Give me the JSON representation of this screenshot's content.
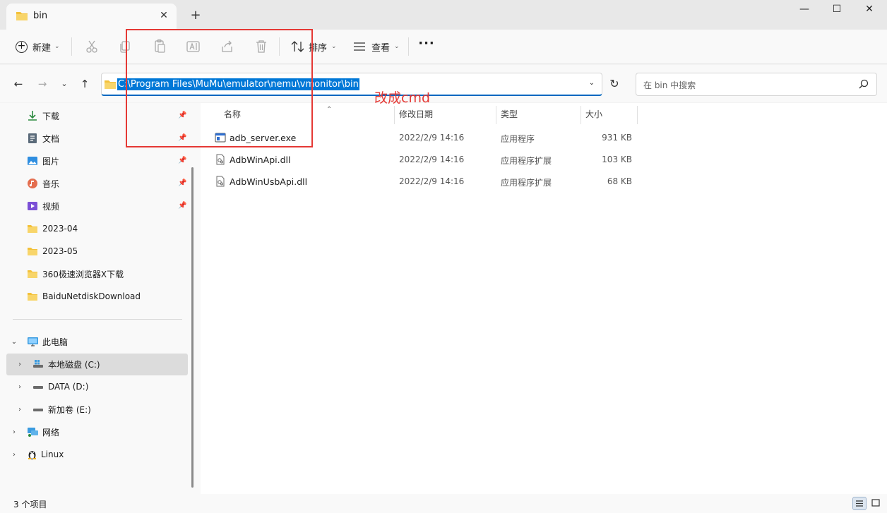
{
  "tab": {
    "title": "bin"
  },
  "toolbar": {
    "new_label": "新建",
    "sort_label": "排序",
    "view_label": "查看"
  },
  "address": {
    "path": "C:\\Program Files\\MuMu\\emulator\\nemu\\vmonitor\\bin"
  },
  "search": {
    "placeholder": "在 bin 中搜索"
  },
  "sidebar": {
    "quick_access": [
      {
        "label": "下载",
        "icon": "download-icon"
      },
      {
        "label": "文档",
        "icon": "document-icon"
      },
      {
        "label": "图片",
        "icon": "pictures-icon"
      },
      {
        "label": "音乐",
        "icon": "music-icon"
      },
      {
        "label": "视频",
        "icon": "video-icon"
      },
      {
        "label": "2023-04",
        "icon": "folder-icon"
      },
      {
        "label": "2023-05",
        "icon": "folder-icon"
      },
      {
        "label": "360极速浏览器X下载",
        "icon": "folder-icon"
      },
      {
        "label": "BaiduNetdiskDownload",
        "icon": "folder-icon"
      }
    ],
    "tree": [
      {
        "label": "此电脑",
        "icon": "computer-icon"
      },
      {
        "label": "本地磁盘 (C:)",
        "icon": "drive-icon"
      },
      {
        "label": "DATA (D:)",
        "icon": "drive-icon"
      },
      {
        "label": "新加卷 (E:)",
        "icon": "drive-icon"
      },
      {
        "label": "网络",
        "icon": "network-icon"
      },
      {
        "label": "Linux",
        "icon": "linux-icon"
      }
    ]
  },
  "columns": {
    "name": "名称",
    "modified": "修改日期",
    "type": "类型",
    "size": "大小"
  },
  "files": [
    {
      "name": "adb_server.exe",
      "modified": "2022/2/9 14:16",
      "type": "应用程序",
      "size": "931 KB",
      "icon": "exe-icon"
    },
    {
      "name": "AdbWinApi.dll",
      "modified": "2022/2/9 14:16",
      "type": "应用程序扩展",
      "size": "103 KB",
      "icon": "dll-icon"
    },
    {
      "name": "AdbWinUsbApi.dll",
      "modified": "2022/2/9 14:16",
      "type": "应用程序扩展",
      "size": "68 KB",
      "icon": "dll-icon"
    }
  ],
  "status": {
    "count": "3 个项目"
  },
  "annotation": {
    "text": "改成cmd",
    "color": "#e53935"
  },
  "colors": {
    "accent": "#0078d7",
    "folder": "#f3c13a"
  }
}
